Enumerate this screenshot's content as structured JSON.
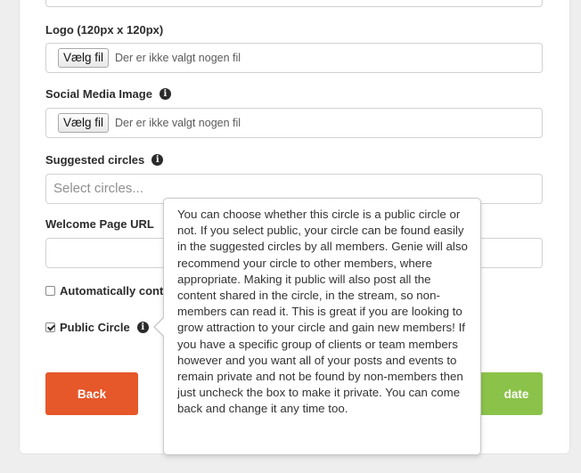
{
  "colors": {
    "back_button": "#e6572a",
    "update_button": "#8bc34a",
    "text": "#2b2b2b"
  },
  "logo": {
    "label": "Logo (120px x 120px)",
    "file_button": "Vælg fil",
    "file_status": "Der er ikke valgt nogen fil"
  },
  "social_image": {
    "label": "Social Media Image",
    "icon": "info-icon",
    "file_button": "Vælg fil",
    "file_status": "Der er ikke valgt nogen fil"
  },
  "suggested_circles": {
    "label": "Suggested circles",
    "icon": "info-icon",
    "placeholder": "Select circles..."
  },
  "welcome_page": {
    "label": "Welcome Page URL",
    "value": ""
  },
  "automatically": {
    "label": "Automatically cont",
    "checked": false
  },
  "public_circle": {
    "label": "Public Circle",
    "icon": "info-icon",
    "checked": true
  },
  "buttons": {
    "back": "Back",
    "update": "date"
  },
  "tooltip": {
    "text": "You can choose whether this circle is a public circle or not. If you select public, your circle can be found easily in the suggested circles by all members. Genie will also recommend your circle to other members, where appropriate. Making it public will also post all the content shared in the circle, in the stream, so non-members can read it. This is great if you are looking to grow attraction to your circle and gain new members! If you have a specific group of clients or team members however and you want all of your posts and events to remain private and not be found by non-members then just uncheck the box to make it private. You can come back and change it any time too."
  }
}
